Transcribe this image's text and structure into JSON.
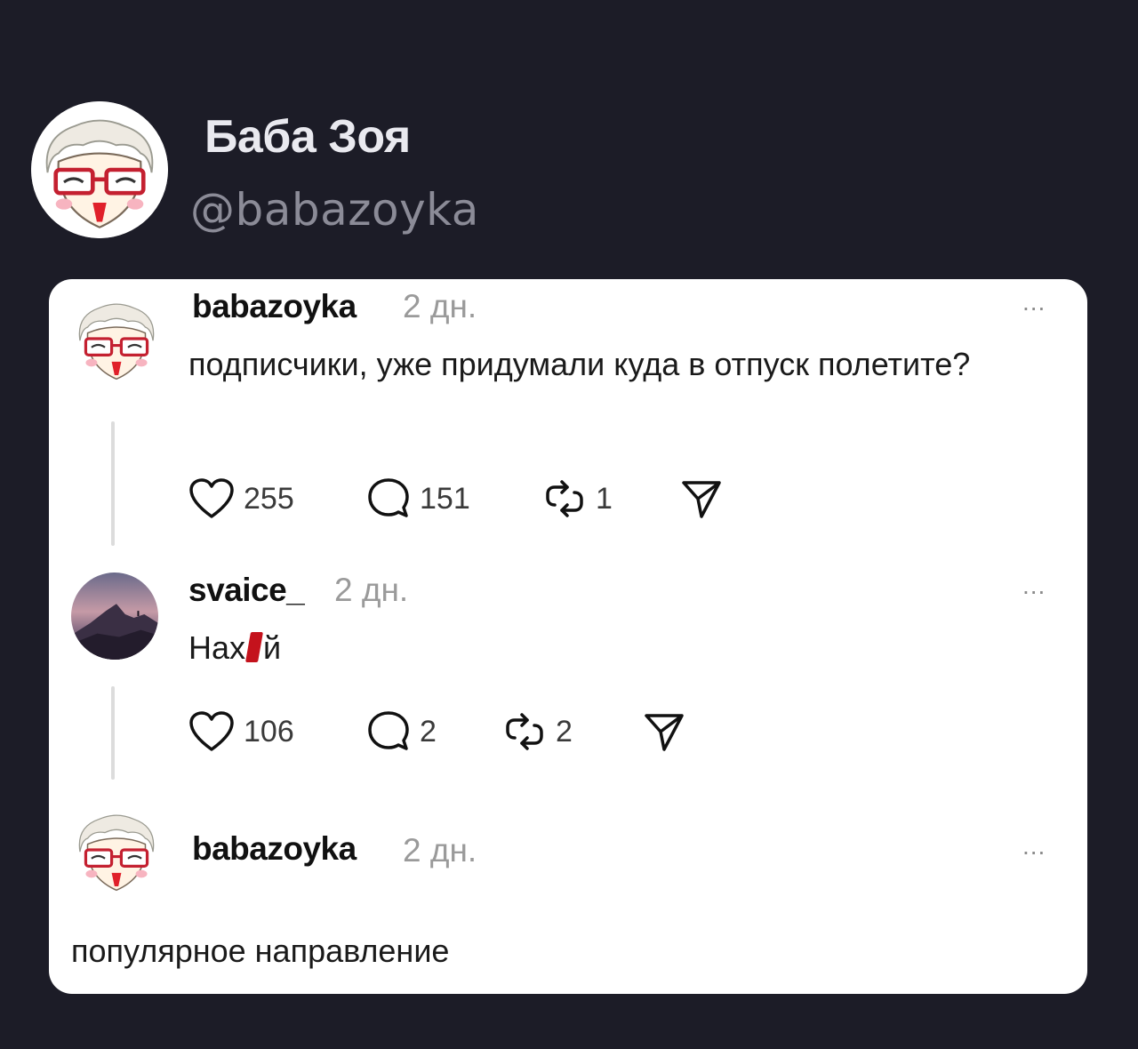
{
  "profile": {
    "name": "Баба Зоя",
    "handle": "@babazoyka"
  },
  "posts": [
    {
      "username": "babazoyka",
      "time": "2 дн.",
      "menu": "...",
      "text": "подписчики, уже придумали куда в отпуск полетите?",
      "likes": "255",
      "comments": "151",
      "reposts": "1"
    },
    {
      "username": "svaice_",
      "time": "2 дн.",
      "menu": "...",
      "text_before": "Нах",
      "text_after": "й",
      "likes": "106",
      "comments": "2",
      "reposts": "2"
    },
    {
      "username": "babazoyka",
      "time": "2 дн.",
      "menu": "..."
    }
  ],
  "caption": "популярное направление",
  "icons": {
    "like": "heart-icon",
    "comment": "comment-icon",
    "repost": "repost-icon",
    "share": "send-icon"
  },
  "colors": {
    "background": "#1c1c27",
    "card": "#ffffff",
    "censor": "#c4121c"
  }
}
